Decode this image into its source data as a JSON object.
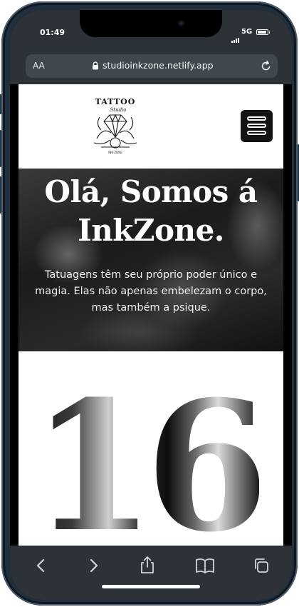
{
  "status_bar": {
    "time": "01:49",
    "network": "5G"
  },
  "browser": {
    "text_size_label": "AA",
    "url": "studioinkzone.netlify.app"
  },
  "site": {
    "logo_text": "TATTOO Studio",
    "hero": {
      "title": "Olá, Somos á InkZone.",
      "subtitle": "Tatuagens têm seu próprio poder único e magia. Elas não apenas embelezam o corpo, mas também a psique."
    },
    "stat_number": "16"
  },
  "icons": {
    "menu": "hamburger-menu-icon",
    "back": "chevron-left-icon",
    "forward": "chevron-right-icon",
    "share": "share-icon",
    "bookmarks": "book-icon",
    "tabs": "tabs-icon",
    "reload": "reload-icon",
    "lock": "lock-icon"
  },
  "colors": {
    "browser_chrome": "#2c3238",
    "url_pill": "#41474e",
    "phone_frame": "#1f2f3d",
    "menu_button": "#131313"
  }
}
